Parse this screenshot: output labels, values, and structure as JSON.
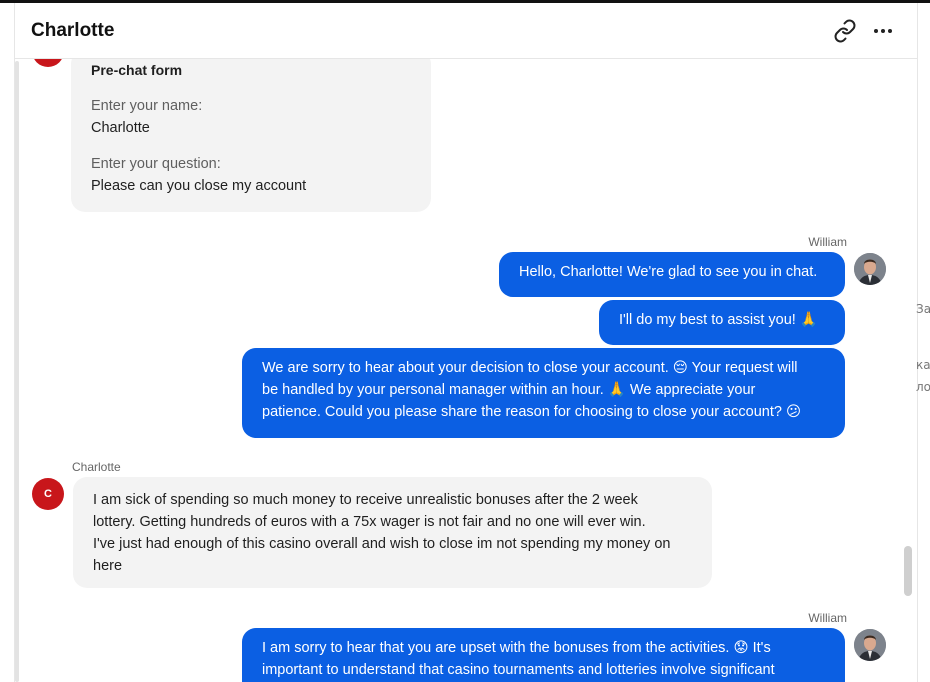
{
  "header": {
    "title": "Charlotte"
  },
  "icons": {
    "link": "link-icon",
    "more": "more-options-icon"
  },
  "prechat": {
    "title": "Pre-chat form",
    "name_label": "Enter your name:",
    "name_value": "Charlotte",
    "question_label": "Enter your question:",
    "question_value": "Please can you close my account"
  },
  "agent": {
    "name": "William"
  },
  "customer": {
    "name": "Charlotte",
    "initial": "C"
  },
  "messages": {
    "m1": "Hello, Charlotte! We're glad to see you in chat.",
    "m2": "I'll do my best to assist you! 🙏",
    "m3_line1": "We are sorry to hear about your decision to close your account. 😔 Your request will",
    "m3_line2": "be handled by your personal manager within an hour. 🙏 We appreciate your",
    "m3_line3": "patience. Could you please share the reason for choosing to close your account? 😕",
    "c1_line1": "I am sick of spending so much money to receive unrealistic bonuses after the 2 week",
    "c1_line2": "lottery. Getting hundreds of euros with a 75x wager is not fair and no one will ever win.",
    "c1_line3": "I've just had enough of this casino overall and wish to close im not spending my money on",
    "c1_line4": "here",
    "m4_line1": "I am sorry to hear that you are upset with the bonuses from the activities. 😟 It's",
    "m4_line2": "important to understand that casino tournaments and lotteries involve significant"
  },
  "edge_fragments": [
    "За",
    "ка",
    "ло"
  ],
  "colors": {
    "outgoing_bubble": "#0b5fe3",
    "incoming_bubble": "#f3f3f3",
    "customer_avatar": "#c8161b"
  }
}
